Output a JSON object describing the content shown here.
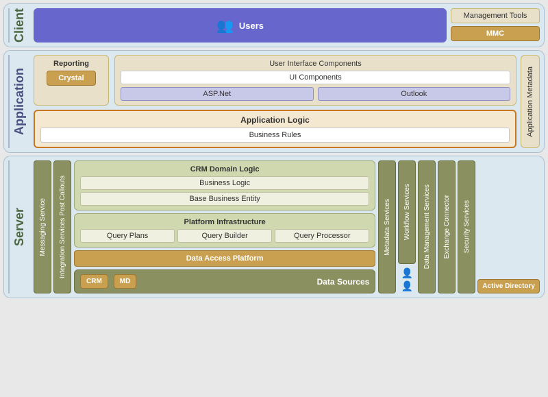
{
  "tiers": {
    "client": {
      "label": "Client",
      "users_label": "Users",
      "management_tools_label": "Management Tools",
      "mmc_label": "MMC"
    },
    "application": {
      "label": "Application",
      "reporting_label": "Reporting",
      "crystal_label": "Crystal",
      "ui_components_title": "User Interface Components",
      "ui_components_label": "UI Components",
      "aspnet_label": "ASP.Net",
      "outlook_label": "Outlook",
      "app_logic_label": "Application Logic",
      "business_rules_label": "Business Rules",
      "app_metadata_label": "Application Metadata"
    },
    "server": {
      "label": "Server",
      "messaging_service_label": "Messaging Service",
      "integration_services_label": "Integration Services Post Callouts",
      "crm_domain_label": "CRM Domain Logic",
      "business_logic_label": "Business Logic",
      "base_business_entity_label": "Base Business Entity",
      "platform_label": "Platform Infrastructure",
      "query_plans_label": "Query Plans",
      "query_builder_label": "Query Builder",
      "query_processor_label": "Query Processor",
      "metadata_services_label": "Metadata Services",
      "workflow_services_label": "Workflow Services",
      "data_mgmt_services_label": "Data Management Services",
      "exchange_connector_label": "Exchange Connector",
      "security_services_label": "Security Services",
      "data_access_label": "Data Access Platform",
      "data_sources_label": "Data Sources",
      "crm_db_label": "CRM",
      "md_db_label": "MD",
      "active_directory_label": "Active Directory"
    }
  }
}
